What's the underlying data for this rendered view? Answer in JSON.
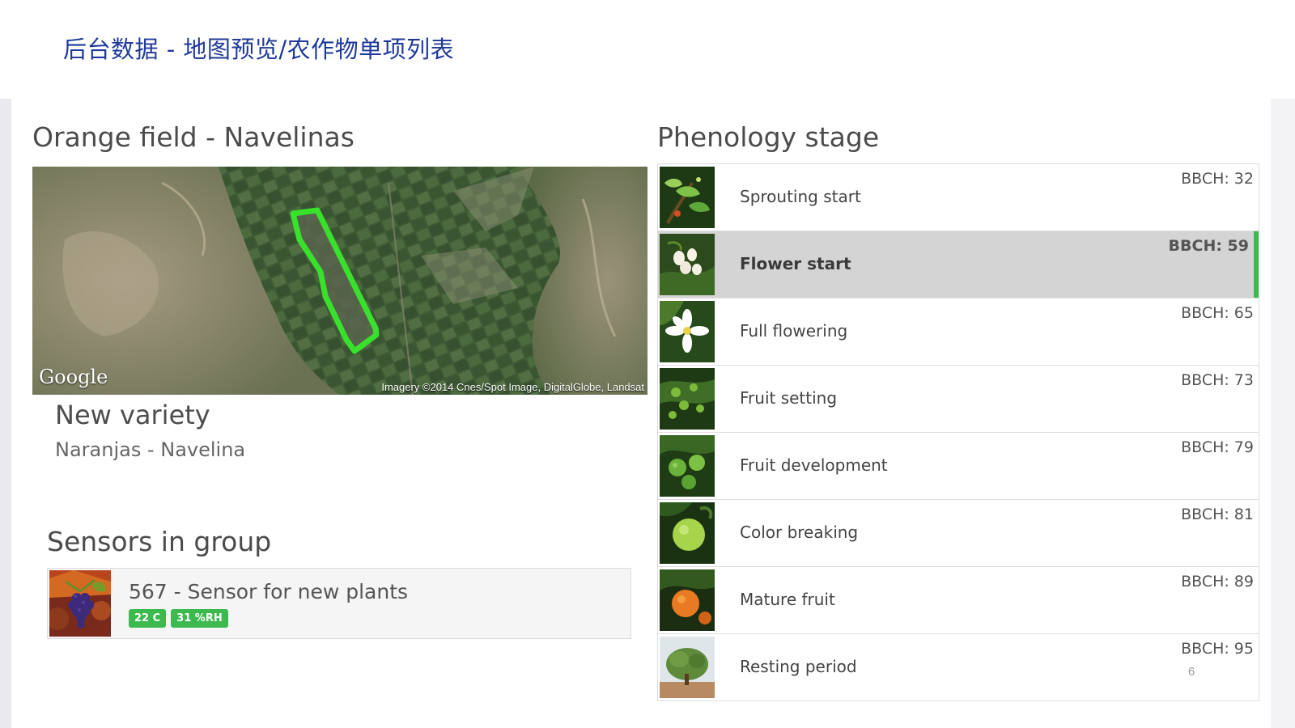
{
  "slide": {
    "title": "后台数据 - 地图预览/农作物单项列表",
    "page_number": "6"
  },
  "field": {
    "title": "Orange field - Navelinas",
    "map_logo": "Google",
    "map_attribution": "Imagery ©2014 Cnes/Spot Image, DigitalGlobe, Landsat",
    "variety_title": "New variety",
    "variety_name": "Naranjas - Navelina"
  },
  "sensors": {
    "title": "Sensors in group",
    "items": [
      {
        "name": "567 - Sensor for new plants",
        "temperature": "22 C",
        "humidity": "31 %RH",
        "thumb_icon": "grapes-image"
      }
    ]
  },
  "phenology": {
    "title": "Phenology stage",
    "stages": [
      {
        "label": "Sprouting start",
        "bbch": "BBCH: 32",
        "icon": "sprout-image"
      },
      {
        "label": "Flower start",
        "bbch": "BBCH: 59",
        "icon": "flower-bud-image",
        "active": true
      },
      {
        "label": "Full flowering",
        "bbch": "BBCH: 65",
        "icon": "open-flower-image"
      },
      {
        "label": "Fruit setting",
        "bbch": "BBCH: 73",
        "icon": "fruit-set-image"
      },
      {
        "label": "Fruit development",
        "bbch": "BBCH: 79",
        "icon": "green-fruit-image"
      },
      {
        "label": "Color breaking",
        "bbch": "BBCH: 81",
        "icon": "color-break-image"
      },
      {
        "label": "Mature fruit",
        "bbch": "BBCH: 89",
        "icon": "mature-orange-image"
      },
      {
        "label": "Resting period",
        "bbch": "BBCH: 95",
        "icon": "tree-image"
      }
    ]
  },
  "colors": {
    "title_blue": "#1f3a9a",
    "accent_green": "#3dba4e",
    "active_row": "#d4d4d4"
  }
}
